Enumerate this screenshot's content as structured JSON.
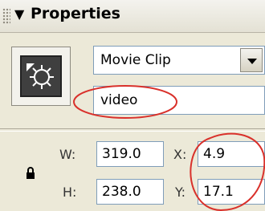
{
  "panel": {
    "title": "Properties",
    "collapse_icon": "triangle-down-icon"
  },
  "symbol": {
    "icon": "movie-clip-symbol-icon",
    "type_select": {
      "value": "Movie Clip",
      "options": [
        "Movie Clip"
      ]
    },
    "instance_name": "video"
  },
  "geometry": {
    "lock_icon": "lock-icon",
    "w_label": "W:",
    "w_value": "319.0",
    "h_label": "H:",
    "h_value": "238.0",
    "x_label": "X:",
    "x_value": "4.9",
    "y_label": "Y:",
    "y_value": "17.1"
  },
  "colors": {
    "panel_bg": "#ece9d8",
    "annotation": "#d9312b",
    "input_border": "#7f9db9"
  }
}
